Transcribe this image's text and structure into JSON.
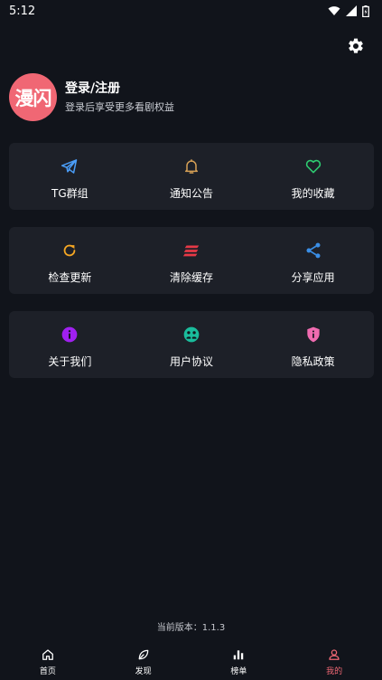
{
  "status_bar": {
    "time": "5:12",
    "icons": [
      "wifi-icon",
      "signal-icon",
      "battery-icon"
    ]
  },
  "profile": {
    "avatar_text": "漫闪",
    "title": "登录/注册",
    "subtitle": "登录后享受更多看剧权益"
  },
  "cards": [
    {
      "items": [
        {
          "label": "TG群组",
          "icon": "telegram-icon",
          "color": "#4a9df8"
        },
        {
          "label": "通知公告",
          "icon": "bell-icon",
          "color": "#d6a056"
        },
        {
          "label": "我的收藏",
          "icon": "heart-icon",
          "color": "#2ecc71"
        }
      ]
    },
    {
      "items": [
        {
          "label": "检查更新",
          "icon": "refresh-icon",
          "color": "#f5a623"
        },
        {
          "label": "清除缓存",
          "icon": "clear-cache-icon",
          "color": "#e63946"
        },
        {
          "label": "分享应用",
          "icon": "share-icon",
          "color": "#3a8ee6"
        }
      ]
    },
    {
      "items": [
        {
          "label": "关于我们",
          "icon": "info-icon",
          "color": "#a020f0"
        },
        {
          "label": "用户协议",
          "icon": "agreement-icon",
          "color": "#1abc9c"
        },
        {
          "label": "隐私政策",
          "icon": "privacy-shield-icon",
          "color": "#f06bb0"
        }
      ]
    }
  ],
  "version": "当前版本：1.1.3",
  "tabbar": {
    "tabs": [
      {
        "label": "首页",
        "icon": "home-icon"
      },
      {
        "label": "发现",
        "icon": "leaf-icon"
      },
      {
        "label": "榜单",
        "icon": "bar-chart-icon"
      },
      {
        "label": "我的",
        "icon": "person-icon"
      }
    ],
    "active_color": "#f06774"
  }
}
